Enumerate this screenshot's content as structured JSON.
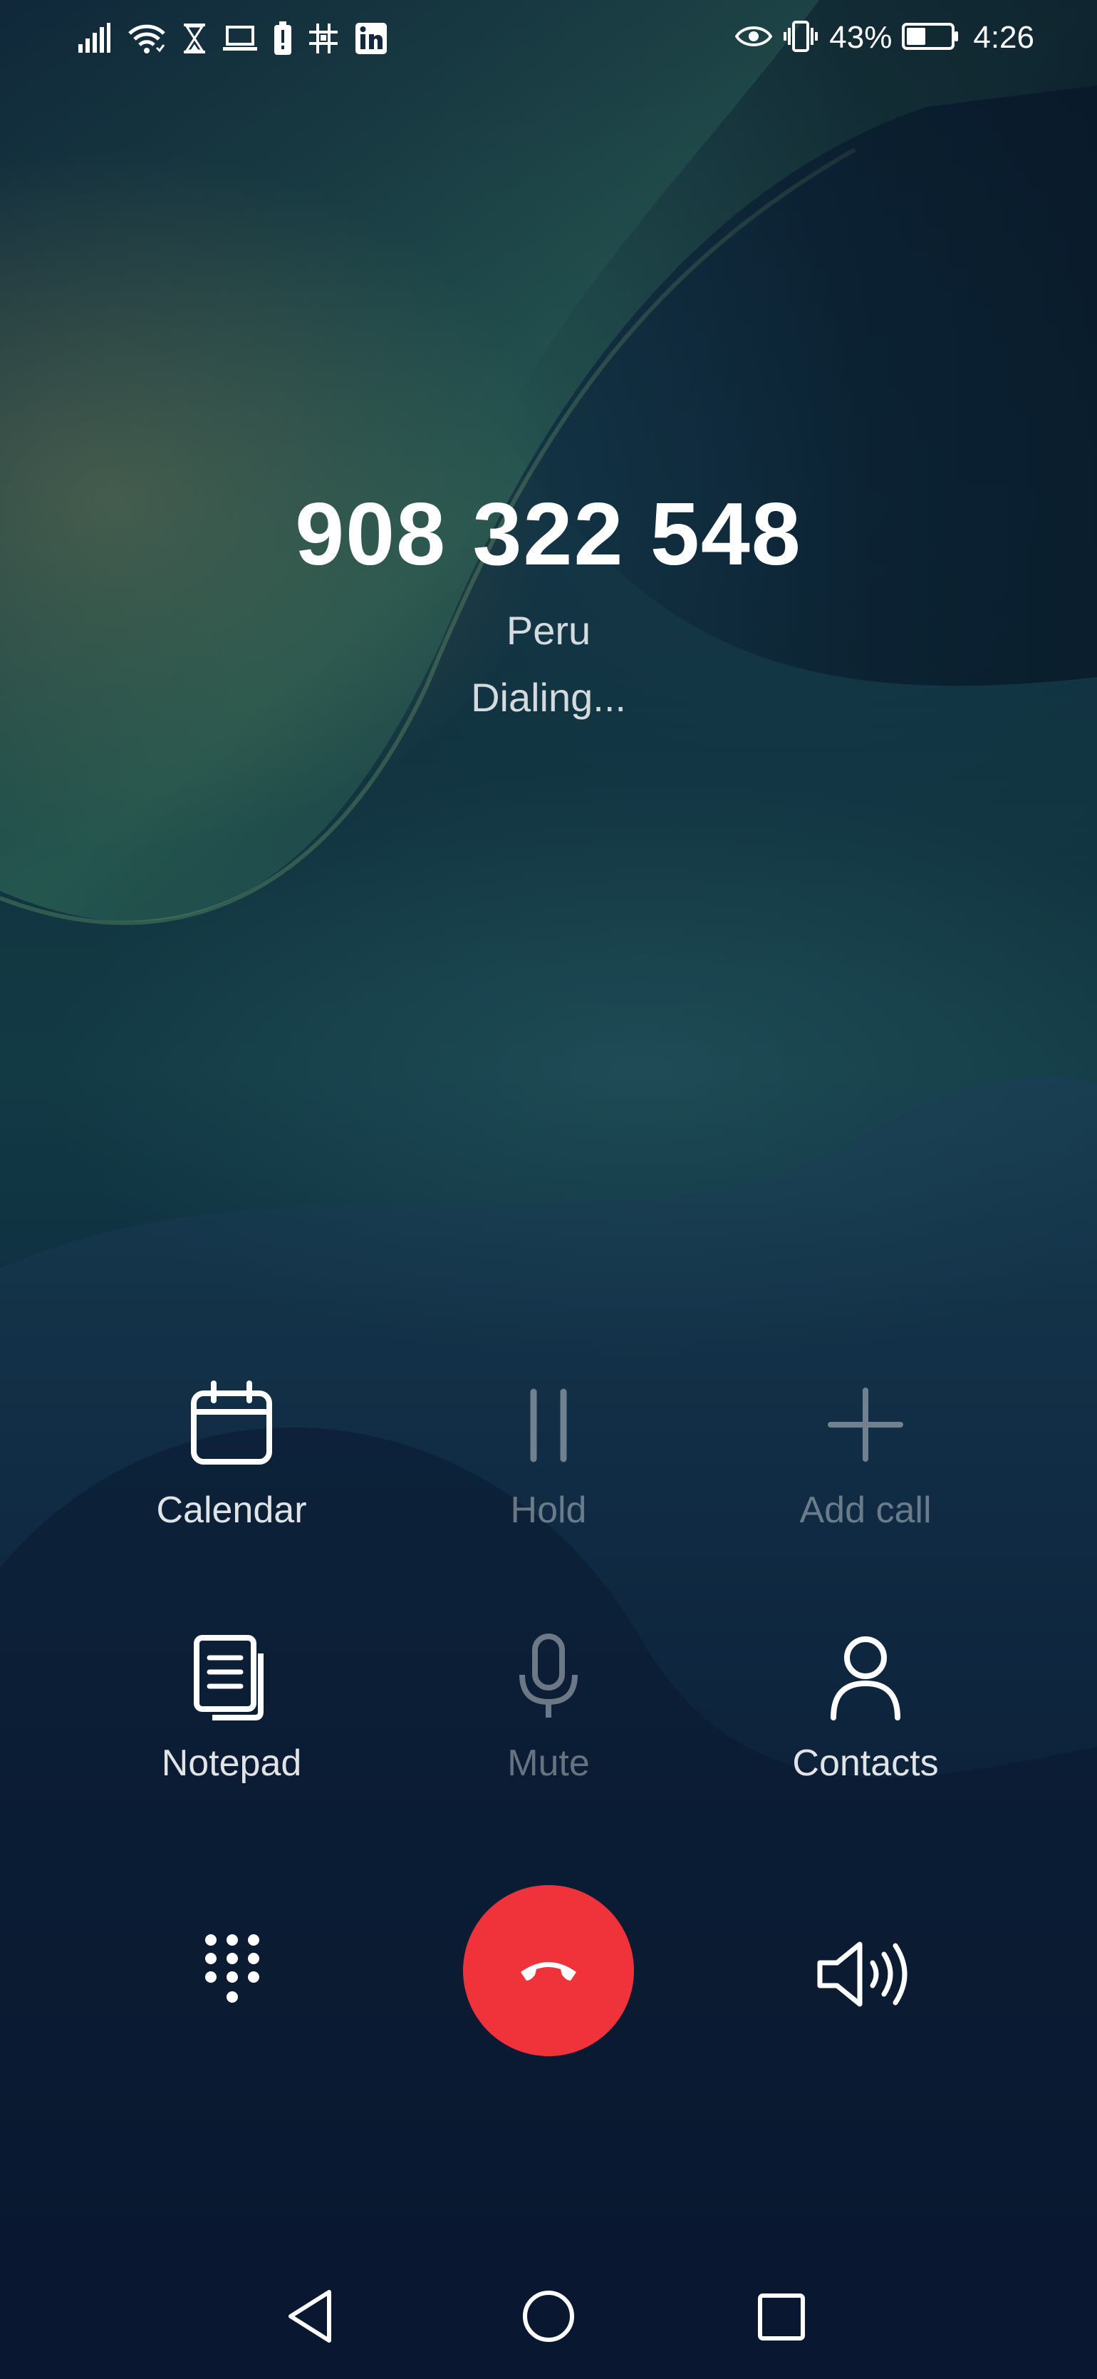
{
  "status_bar": {
    "battery_percent": "43%",
    "time": "4:26",
    "icons_left": [
      "signal-icon",
      "wifi-icon",
      "hourglass-icon",
      "laptop-icon",
      "battery-alert-icon",
      "hashtag-icon",
      "linkedin-icon"
    ],
    "icons_right": [
      "eye-icon",
      "vibrate-icon",
      "battery-icon"
    ],
    "battery_level": 0.43
  },
  "call": {
    "number": "908 322 548",
    "location": "Peru",
    "status": "Dialing..."
  },
  "actions": {
    "calendar": {
      "label": "Calendar",
      "icon": "calendar-icon",
      "enabled": true
    },
    "hold": {
      "label": "Hold",
      "icon": "pause-icon",
      "enabled": false
    },
    "add_call": {
      "label": "Add call",
      "icon": "plus-icon",
      "enabled": false
    },
    "notepad": {
      "label": "Notepad",
      "icon": "notepad-icon",
      "enabled": true
    },
    "mute": {
      "label": "Mute",
      "icon": "microphone-icon",
      "enabled": false
    },
    "contacts": {
      "label": "Contacts",
      "icon": "person-icon",
      "enabled": true
    }
  },
  "controls": {
    "dialpad_icon": "dialpad-icon",
    "end_call_icon": "hang-up-icon",
    "speaker_icon": "speaker-icon"
  },
  "navigation": {
    "back_icon": "back-triangle-icon",
    "home_icon": "home-circle-icon",
    "recents_icon": "recents-square-icon"
  },
  "colors": {
    "end_call": "#f0333b",
    "text_primary": "#ffffff",
    "text_disabled": "rgba(255,255,255,0.38)"
  }
}
